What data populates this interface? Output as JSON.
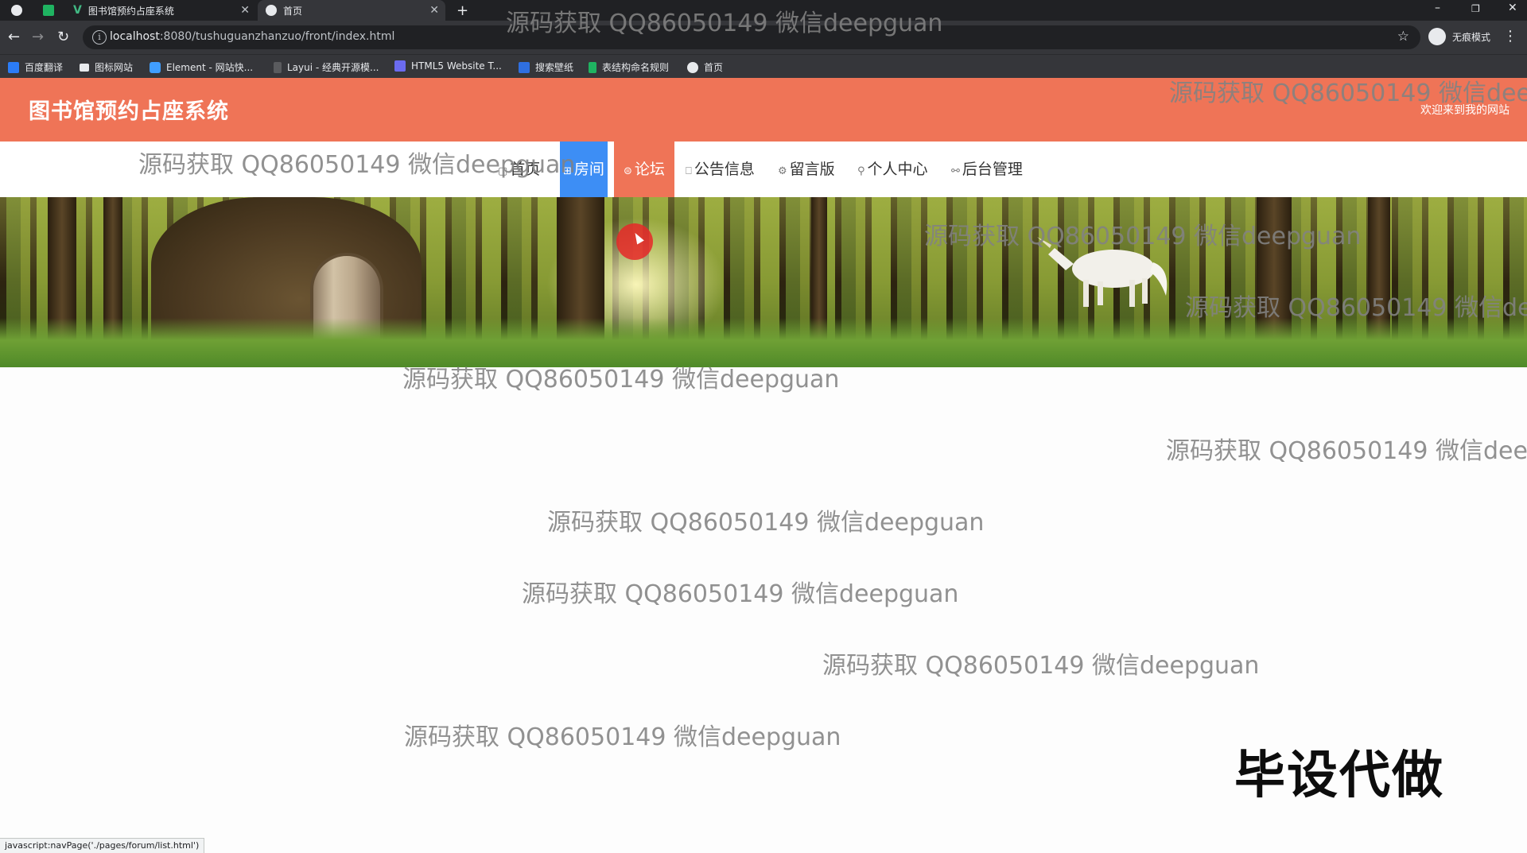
{
  "browser": {
    "tabs": [
      {
        "title": "",
        "active": false
      },
      {
        "title": "图书馆预约占座系统",
        "active": false
      },
      {
        "title": "首页",
        "active": true
      }
    ],
    "new_tab_label": "+",
    "url_host": "localhost",
    "url_rest": ":8080/tushuguanzhanzuo/front/index.html",
    "incognito_label": "无痕模式",
    "bookmarks": [
      "百度翻译",
      "图标网站",
      "Element - 网站快...",
      "Layui - 经典开源模...",
      "HTML5 Website T...",
      "搜索壁纸",
      "表结构命名规则",
      "首页"
    ]
  },
  "site": {
    "title": "图书馆预约占座系统",
    "welcome": "欢迎来到我的网站"
  },
  "nav": {
    "items": [
      {
        "label": "首页",
        "icon": "home-icon"
      },
      {
        "label": "房间",
        "icon": "grid-icon"
      },
      {
        "label": "论坛",
        "icon": "forum-icon"
      },
      {
        "label": "公告信息",
        "icon": "book-icon"
      },
      {
        "label": "留言版",
        "icon": "gear-icon"
      },
      {
        "label": "个人中心",
        "icon": "user-icon"
      },
      {
        "label": "后台管理",
        "icon": "link-icon"
      }
    ]
  },
  "watermarks": {
    "text": "源码获取 QQ86050149 微信deepguan",
    "clipped": "源码获取 QQ86050149 微信deep",
    "clipped_short": "源码获取 QQ86050149 微信dee"
  },
  "overlay": {
    "stamp": "毕设代做"
  },
  "status_bar": "javascript:navPage('./pages/forum/list.html')",
  "colors": {
    "header": "#ef7457",
    "nav_active_room": "#3d8ef5",
    "nav_active_forum": "#ef7457"
  }
}
